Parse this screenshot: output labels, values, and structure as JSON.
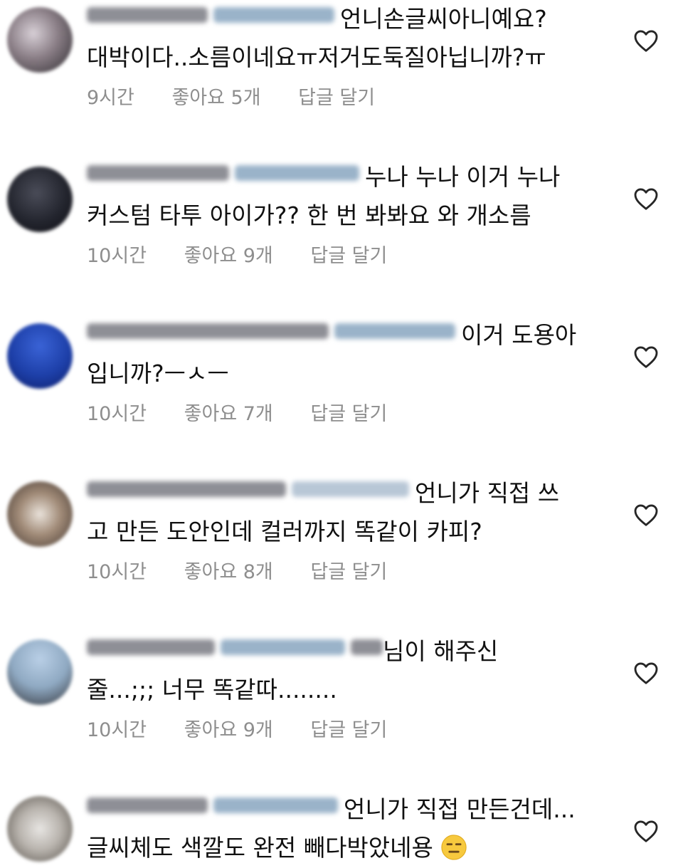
{
  "comments": [
    {
      "text_line1": "언니손글씨아니예요?",
      "text_line2": "대박이다..소름이네요ㅠ저거도둑질아닙니까?ㅠ",
      "time": "9시간",
      "likes": "좋아요 5개",
      "reply": "답글 달기"
    },
    {
      "text_line1": "누나 누나 이거 누나",
      "text_line2": "커스텀 타투 아이가?? 한 번 봐봐요 와 개소름",
      "time": "10시간",
      "likes": "좋아요 9개",
      "reply": "답글 달기"
    },
    {
      "text_line1": "이거 도용아",
      "text_line2": "입니까?ㅡㅅㅡ",
      "time": "10시간",
      "likes": "좋아요 7개",
      "reply": "답글 달기"
    },
    {
      "text_line1": "언니가 직접 쓰",
      "text_line2": "고 만든 도안인데 컬러까지 똑같이 카피?",
      "time": "10시간",
      "likes": "좋아요 8개",
      "reply": "답글 달기"
    },
    {
      "text_line1": "님이 해주신",
      "text_line2": "줄...;;; 너무 똑같따........",
      "time": "10시간",
      "likes": "좋아요 9개",
      "reply": "답글 달기"
    },
    {
      "text_line1": "언니가 직접 만든건데...",
      "text_line2": "글씨체도 색깔도 완전 빼다박았네용",
      "time": "",
      "likes": "",
      "reply": ""
    }
  ],
  "icons": {
    "like": "heart-outline-icon",
    "emoji": "expressionless-face-emoji"
  },
  "colors": {
    "meta_text": "#8e8e8e",
    "heart_stroke": "#262626"
  }
}
